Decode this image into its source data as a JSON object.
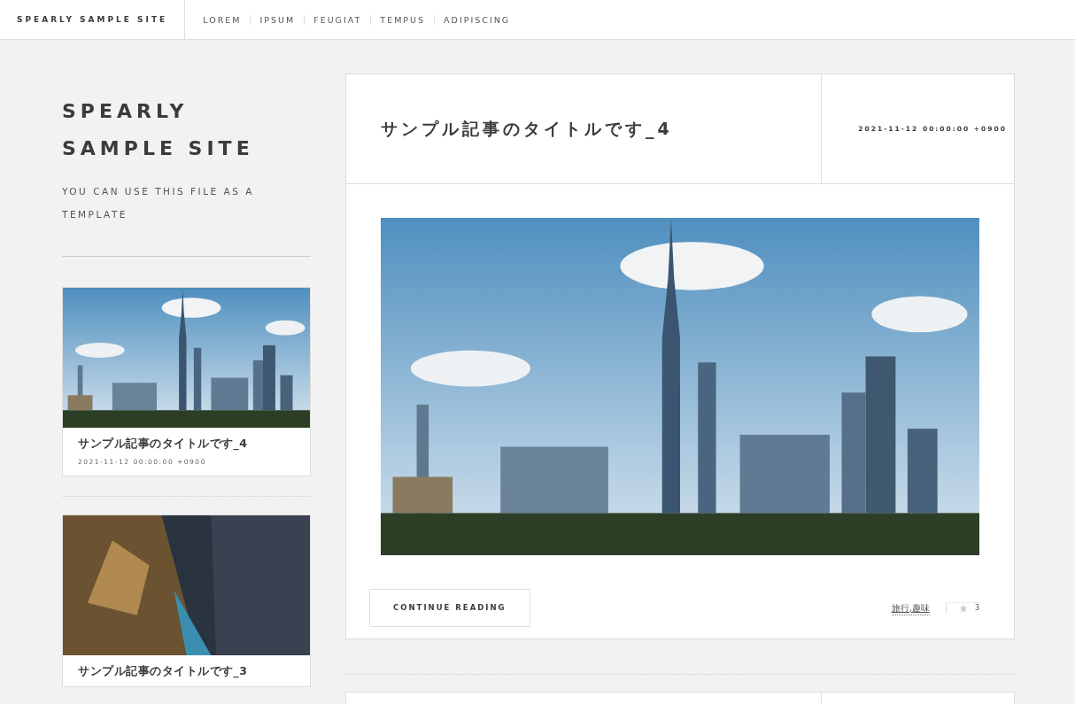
{
  "navbar": {
    "brand": "SPEARLY SAMPLE SITE",
    "links": [
      "LOREM",
      "IPSUM",
      "FEUGIAT",
      "TEMPUS",
      "ADIPISCING"
    ]
  },
  "sidebar": {
    "title": "SPEARLY SAMPLE SITE",
    "subtitle": "YOU CAN USE THIS FILE AS A TEMPLATE",
    "mini_posts": [
      {
        "title": "サンプル記事のタイトルです_4",
        "date": "2021-11-12 00:00:00 +0900"
      },
      {
        "title": "サンプル記事のタイトルです_3"
      }
    ]
  },
  "post": {
    "title": "サンプル記事のタイトルです_4",
    "date": "2021-11-12 00:00:00 +0900",
    "button": "CONTINUE READING",
    "tags": "旅行,趣味",
    "likes": "3"
  }
}
